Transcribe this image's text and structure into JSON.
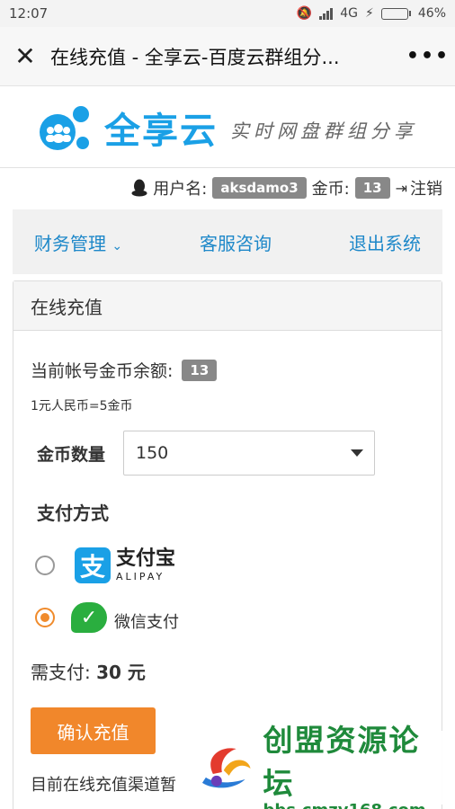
{
  "status_bar": {
    "time": "12:07",
    "network": "4G",
    "battery": "46%",
    "battery_level": 0.46
  },
  "app_bar": {
    "title": "在线充值 - 全享云-百度云群组分...",
    "close_icon": "close-icon",
    "more_icon": "more-icon"
  },
  "header": {
    "logo_name": "全享云",
    "slogan": "实时网盘群组分享",
    "brand_color": "#1aa0e6"
  },
  "user": {
    "username_label": "用户名:",
    "username": "aksdamo3",
    "coins_label": "金币:",
    "coins": "13",
    "logout": "注销"
  },
  "nav": {
    "items": [
      "财务管理",
      "客服咨询",
      "退出系统"
    ]
  },
  "panel": {
    "title": "在线充值",
    "balance_label": "当前帐号金币余额:",
    "balance_value": "13",
    "rate": "1元人民币=5金币",
    "coin_label": "金币数量",
    "coin_value": "150",
    "pay_title": "支付方式",
    "alipay_cn": "支付宝",
    "alipay_en": "ALIPAY",
    "wechat_label": "微信支付",
    "need_pay_label": "需支付:",
    "need_pay_amount": "30 元",
    "confirm_label": "确认充值",
    "notice": "目前在线充值渠道暂"
  },
  "watermark": {
    "name": "创盟资源论坛",
    "url": "bbs.cmzy168.com"
  },
  "colors": {
    "accent": "#f1872b",
    "link": "#1e88c9",
    "wechat": "#2aae3f"
  }
}
